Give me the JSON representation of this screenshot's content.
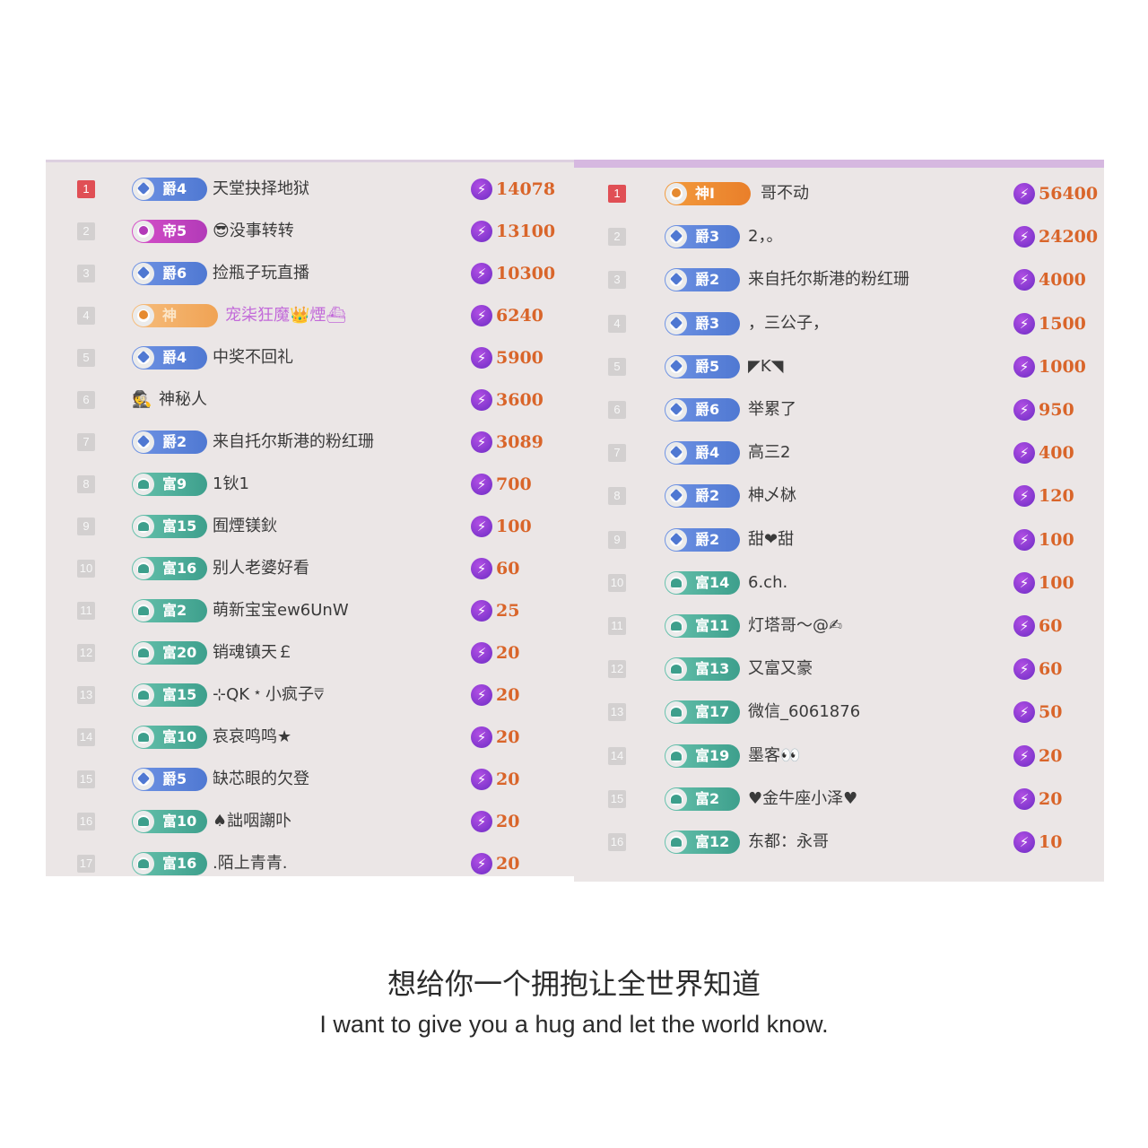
{
  "left_panel": {
    "rows": [
      {
        "rank": "1",
        "badge_type": "jue",
        "badge_label": "爵4",
        "name": "天堂抉择地狱",
        "score": "14078"
      },
      {
        "rank": "2",
        "badge_type": "di",
        "badge_label": "帝5",
        "name": "😎没事转转",
        "score": "13100"
      },
      {
        "rank": "3",
        "badge_type": "jue",
        "badge_label": "爵6",
        "name": "捡瓶子玩直播",
        "score": "10300"
      },
      {
        "rank": "4",
        "badge_type": "shen_faded",
        "badge_label": "神",
        "name": "宠柒狂魔👑煙⛴",
        "score": "6240"
      },
      {
        "rank": "5",
        "badge_type": "jue",
        "badge_label": "爵4",
        "name": "中奖不回礼",
        "score": "5900"
      },
      {
        "rank": "6",
        "badge_type": "secret",
        "badge_label": "",
        "name": "神秘人",
        "score": "3600"
      },
      {
        "rank": "7",
        "badge_type": "jue",
        "badge_label": "爵2",
        "name": "来自托尔斯港的粉红珊",
        "score": "3089"
      },
      {
        "rank": "8",
        "badge_type": "fu",
        "badge_label": "富9",
        "name": "1钬1",
        "score": "700"
      },
      {
        "rank": "9",
        "badge_type": "fu",
        "badge_label": "富15",
        "name": "囿煙镁鈥",
        "score": "100"
      },
      {
        "rank": "10",
        "badge_type": "fu",
        "badge_label": "富16",
        "name": "别人老婆好看",
        "score": "60"
      },
      {
        "rank": "11",
        "badge_type": "fu",
        "badge_label": "富2",
        "name": "萌新宝宝ew6UnW",
        "score": "25"
      },
      {
        "rank": "12",
        "badge_type": "fu",
        "badge_label": "富20",
        "name": "销魂镇天￡",
        "score": "20"
      },
      {
        "rank": "13",
        "badge_type": "fu",
        "badge_label": "富15",
        "name": "⊹QK﹡小疯子⩢",
        "score": "20"
      },
      {
        "rank": "14",
        "badge_type": "fu",
        "badge_label": "富10",
        "name": "哀哀鸣鸣★",
        "score": "20"
      },
      {
        "rank": "15",
        "badge_type": "jue",
        "badge_label": "爵5",
        "name": "缺芯眼的欠登",
        "score": "20"
      },
      {
        "rank": "16",
        "badge_type": "fu",
        "badge_label": "富10",
        "name": "♠詘咽謿卟",
        "score": "20"
      },
      {
        "rank": "17",
        "badge_type": "fu",
        "badge_label": "富16",
        "name": ".陌上青青.",
        "score": "20"
      }
    ]
  },
  "right_panel": {
    "rows": [
      {
        "rank": "1",
        "badge_type": "shen",
        "badge_label": "神Ⅰ",
        "name": "哥不动",
        "score": "56400"
      },
      {
        "rank": "2",
        "badge_type": "jue",
        "badge_label": "爵3",
        "name": "2，。",
        "score": "24200"
      },
      {
        "rank": "3",
        "badge_type": "jue",
        "badge_label": "爵2",
        "name": "来自托尔斯港的粉红珊",
        "score": "4000"
      },
      {
        "rank": "4",
        "badge_type": "jue",
        "badge_label": "爵3",
        "name": "，三公子，",
        "score": "1500"
      },
      {
        "rank": "5",
        "badge_type": "jue",
        "badge_label": "爵5",
        "name": "◤K◥",
        "score": "1000"
      },
      {
        "rank": "6",
        "badge_type": "jue",
        "badge_label": "爵6",
        "name": "举累了",
        "score": "950"
      },
      {
        "rank": "7",
        "badge_type": "jue",
        "badge_label": "爵4",
        "name": "高三2",
        "score": "400"
      },
      {
        "rank": "8",
        "badge_type": "jue",
        "badge_label": "爵2",
        "name": "柛乄栤",
        "score": "120"
      },
      {
        "rank": "9",
        "badge_type": "jue",
        "badge_label": "爵2",
        "name": "甜❤甜",
        "score": "100"
      },
      {
        "rank": "10",
        "badge_type": "fu",
        "badge_label": "富14",
        "name": "6.ch.",
        "score": "100"
      },
      {
        "rank": "11",
        "badge_type": "fu",
        "badge_label": "富11",
        "name": "灯塔哥～@✍",
        "score": "60"
      },
      {
        "rank": "12",
        "badge_type": "fu",
        "badge_label": "富13",
        "name": "又富又豪",
        "score": "60"
      },
      {
        "rank": "13",
        "badge_type": "fu",
        "badge_label": "富17",
        "name": "微信_6061876",
        "score": "50"
      },
      {
        "rank": "14",
        "badge_type": "fu",
        "badge_label": "富19",
        "name": "墨客👀",
        "score": "20"
      },
      {
        "rank": "15",
        "badge_type": "fu",
        "badge_label": "富2",
        "name": "♥金牛座小泽♥",
        "score": "20"
      },
      {
        "rank": "16",
        "badge_type": "fu",
        "badge_label": "富12",
        "name": "东都：永哥",
        "score": "10"
      }
    ]
  },
  "caption": {
    "chinese": "想给你一个拥抱让全世界知道",
    "english": "I want to give you a hug and let the world know."
  },
  "icons": {
    "gift": "lightning-icon",
    "secret": "spy-icon"
  },
  "colors": {
    "score": "#d9652a",
    "top_rank": "#e04f55",
    "jue_badge": "#4f78d2",
    "fu_badge": "#3d9f8c",
    "di_badge": "#b23ab8",
    "shen_badge": "#e97f2a"
  }
}
